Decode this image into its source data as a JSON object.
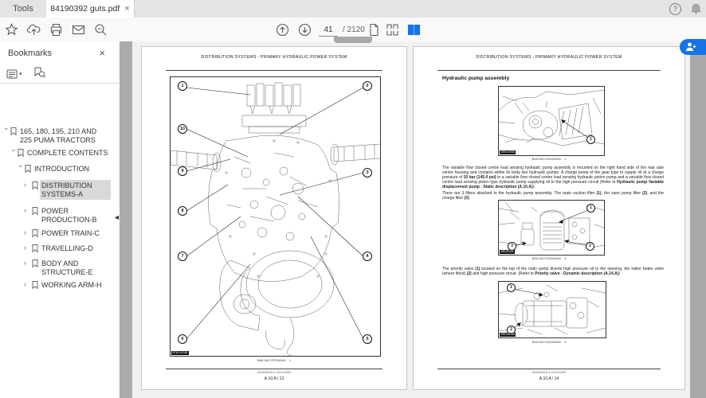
{
  "window": {
    "tabs": [
      {
        "label": "Tools"
      },
      {
        "label": "84190392 guts.pdf"
      }
    ],
    "icons": {
      "close": "×",
      "help": "?",
      "caret": "▾",
      "chevron": "›",
      "collapse": "◄"
    }
  },
  "toolbar": {
    "page_current": "41",
    "page_total": "/ 2120"
  },
  "sidebar": {
    "title": "Bookmarks",
    "items": [
      {
        "label": "165, 180, 195, 210 AND 225 PUMA TRACTORS",
        "level": 0,
        "state": "expanded",
        "selected": false
      },
      {
        "label": "COMPLETE CONTENTS",
        "level": 1,
        "state": "expanded",
        "selected": false
      },
      {
        "label": "INTRODUCTION",
        "level": 2,
        "state": "expanded",
        "selected": false
      },
      {
        "label": "DISTRIBUTION SYSTEMS-A",
        "level": 3,
        "state": "collapsed",
        "selected": true
      },
      {
        "label": "POWER PRODUCTION-B",
        "level": 3,
        "state": "collapsed",
        "selected": false
      },
      {
        "label": "POWER TRAIN-C",
        "level": 3,
        "state": "collapsed",
        "selected": false
      },
      {
        "label": "TRAVELLING-D",
        "level": 3,
        "state": "collapsed",
        "selected": false
      },
      {
        "label": "BODY AND STRUCTURE-E",
        "level": 3,
        "state": "collapsed",
        "selected": false
      },
      {
        "label": "WORKING ARM-H",
        "level": 3,
        "state": "collapsed",
        "selected": false
      }
    ]
  },
  "left_page": {
    "header": "DISTRIBUTION SYSTEMS - PRIMARY HYDRAULIC POWER SYSTEM",
    "figure": {
      "corner_label": "BTB11024B",
      "caption": "BAIL06CCP024AVA    1",
      "callouts": [
        "1",
        "2",
        "3",
        "4",
        "5",
        "6",
        "7",
        "8",
        "9",
        "10"
      ]
    },
    "footer_ref": "84190392A 0 12/01/2009",
    "footer_page": "A.10.A / 13"
  },
  "right_page": {
    "header": "DISTRIBUTION SYSTEMS - PRIMARY HYDRAULIC POWER SYSTEM",
    "heading": "Hydraulic pump assembly",
    "fig1": {
      "corner_label": "BRE1593B",
      "caption": "BAIL06CCM104AVA    2",
      "callouts": [
        "1"
      ]
    },
    "para1": {
      "p0": "The variable flow closed centre load sensing hydraulic pump assembly is mounted on the right hand side of the rear axle centre housing and contains within its body two hydraulic pumps. A charge pump of the gear type to supply oil at a charge pressure of ",
      "p1": "10 bar (145.0 psi)",
      "p2": " to a variable flow closed centre load sensing hydraulic piston pump and a variable flow closed centre load sensing piston type hydraulic pump supplying oil to the high pressure circuit (Refer to ",
      "p3": "Hydraulic pump Variable displacement pump - Static description (A.10.A)",
      "p4": ")."
    },
    "para2": {
      "p0": "There are 3 filters attached to the hydraulic pump assembly. The main suction filter ",
      "p1": "(1)",
      "p2": ", the vane pump filter ",
      "p3": "(2)",
      "p4": ", and the charge filter ",
      "p5": "(3)",
      "p6": "."
    },
    "fig2": {
      "corner_label": "BRI4052B",
      "caption": "BAIL06CCM105AVA    3",
      "callouts": [
        "1",
        "2",
        "3"
      ]
    },
    "para3": {
      "p0": "The priority valve ",
      "p1": "(1)",
      "p2": " located on the top of the main pump diverts high pressure oil to the steering, the trailer brake valve (where fitted) ",
      "p3": "(2)",
      "p4": " and high pressure circuit. (Refer to ",
      "p5": "Priority valve - Dynamic description (A.14.A)",
      "p6": ")"
    },
    "fig3": {
      "corner_label": "BRK5823B",
      "caption": "BAIL06CCM106AVA    4",
      "callouts": [
        "1",
        "2"
      ]
    },
    "footer_ref": "84190392A 0 12/01/2009",
    "footer_page": "A.10.A / 14"
  },
  "colors": {
    "accent": "#1473e6",
    "selection_bg": "#d9d9d9",
    "chrome_icon": "#5a5a5a"
  }
}
